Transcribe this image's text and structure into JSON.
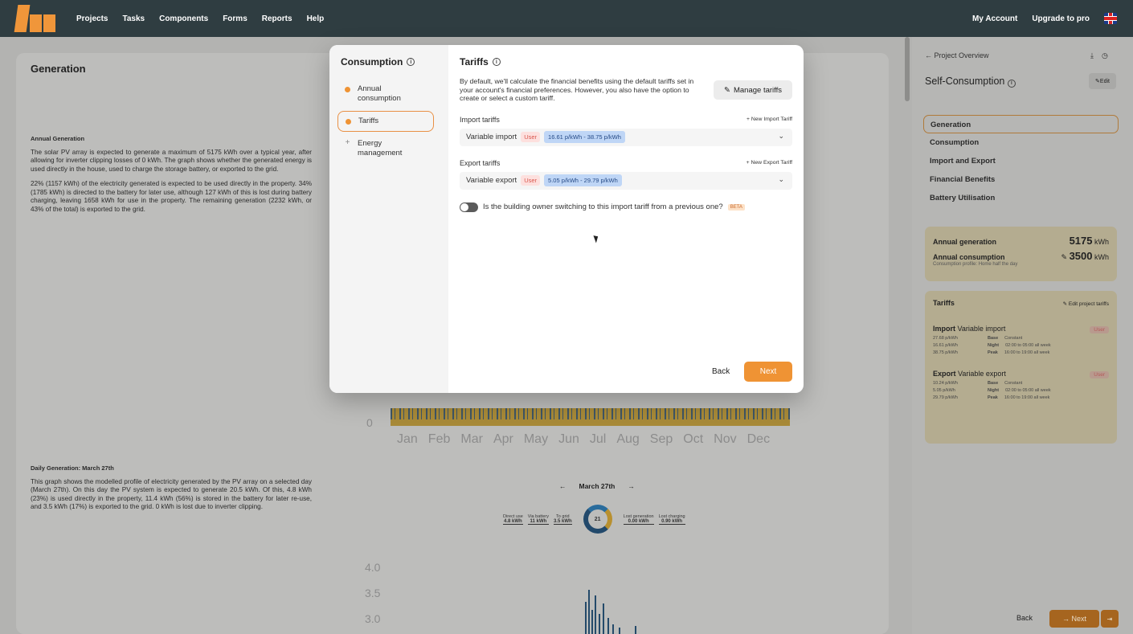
{
  "nav": {
    "links": [
      "Projects",
      "Tasks",
      "Components",
      "Forms",
      "Reports",
      "Help"
    ],
    "account": "My Account",
    "upgrade": "Upgrade to pro"
  },
  "background": {
    "generation_title": "Generation",
    "annual_heading": "Annual Generation",
    "annual_p1": "The solar PV array is expected to generate a maximum of 5175 kWh over a typical year, after allowing for inverter clipping losses of 0 kWh. The graph shows whether the generated energy is used directly in the house, used to charge the storage battery, or exported to the grid.",
    "annual_p2": "22% (1157 kWh) of the electricity generated is expected to be used directly in the property. 34% (1785 kWh) is directed to the battery for later use, although 127 kWh of this is lost during battery charging, leaving 1658 kWh for use in the property. The remaining generation (2232 kWh, or 43% of the total) is exported to the grid.",
    "months": [
      "Jan",
      "Feb",
      "Mar",
      "Apr",
      "May",
      "Jun",
      "Jul",
      "Aug",
      "Sep",
      "Oct",
      "Nov",
      "Dec"
    ],
    "zero": "0",
    "daily_heading": "Daily Generation: March 27th",
    "daily_p": "This graph shows the modelled profile of electricity generated by the PV array on a selected day (March 27th). On this day the PV system is expected to generate 20.5 kWh. Of this, 4.8 kWh (23%) is used directly in the property, 11.4 kWh (56%) is stored in the battery for later re-use, and 3.5 kWh (17%) is exported to the grid. 0 kWh is lost due to inverter clipping.",
    "date_prev": "←",
    "date_label": "March 27th",
    "date_next": "→",
    "stats": [
      {
        "label": "Direct use",
        "value": "4.8 kWh"
      },
      {
        "label": "Via battery",
        "value": "11 kWh"
      },
      {
        "label": "To grid",
        "value": "3.5 kWh"
      }
    ],
    "donut_value": "21",
    "stats_right": [
      {
        "label": "Lost generation",
        "value": "0.00 kWh"
      },
      {
        "label": "Lost charging",
        "value": "0.90 kWh"
      }
    ],
    "y_ticks": [
      "4.0",
      "3.5",
      "3.0"
    ]
  },
  "right_panel": {
    "back_link": "← Project Overview",
    "title": "Self-Consumption",
    "edit_label": "Edit",
    "menu": [
      "Generation",
      "Consumption",
      "Import and Export",
      "Financial Benefits",
      "Battery Utilisation"
    ],
    "annual_generation_label": "Annual generation",
    "annual_generation_value": "5175",
    "annual_generation_unit": "kWh",
    "annual_consumption_label": "Annual consumption",
    "annual_consumption_value": "3500",
    "annual_consumption_unit": "kWh",
    "consumption_profile": "Consumption profile: Home half the day",
    "tariffs_label": "Tariffs",
    "edit_tariffs": "Edit project tariffs",
    "import_label": "Import",
    "import_name": "Variable import",
    "import_badge": "User",
    "import_lines": [
      {
        "price": "27.68 p/kWh",
        "name": "Base",
        "desc": "Constant"
      },
      {
        "price": "16.61 p/kWh",
        "name": "Night",
        "desc": "02:00 to 05:00 all week"
      },
      {
        "price": "38.75 p/kWh",
        "name": "Peak",
        "desc": "16:00 to 19:00 all week"
      }
    ],
    "export_label": "Export",
    "export_name": "Variable export",
    "export_badge": "User",
    "export_lines": [
      {
        "price": "10.24 p/kWh",
        "name": "Base",
        "desc": "Constant"
      },
      {
        "price": "5.05 p/kWh",
        "name": "Night",
        "desc": "02:00 to 05:00 all week"
      },
      {
        "price": "29.79 p/kWh",
        "name": "Peak",
        "desc": "16:00 to 19:00 all week"
      }
    ],
    "back": "Back",
    "next": "→ Next"
  },
  "modal": {
    "side_title": "Consumption",
    "steps": [
      {
        "label": "Annual consumption",
        "state": "done"
      },
      {
        "label": "Tariffs",
        "state": "active"
      },
      {
        "label": "Energy management",
        "state": "pending"
      }
    ],
    "title": "Tariffs",
    "intro": "By default, we'll calculate the financial benefits using the default tariffs set in your account's financial preferences. However, you also have the option to create or select a custom tariff.",
    "manage_button": "Manage tariffs",
    "import_section": "Import tariffs",
    "new_import": "+ New Import Tariff",
    "import_select": {
      "name": "Variable import",
      "badge": "User",
      "range": "16.61 p/kWh - 38.75 p/kWh"
    },
    "export_section": "Export tariffs",
    "new_export": "+ New Export Tariff",
    "export_select": {
      "name": "Variable export",
      "badge": "User",
      "range": "5.05 p/kWh - 29.79 p/kWh"
    },
    "toggle_question": "Is the building owner switching to this import tariff from a previous one?",
    "beta": "BETA",
    "toggle_on": false,
    "back": "Back",
    "next": "Next"
  },
  "colors": {
    "accent": "#ef9334",
    "nav_bg": "#2f3d41",
    "user_badge": "#d9574e",
    "range_badge": "#bfd6f6"
  }
}
